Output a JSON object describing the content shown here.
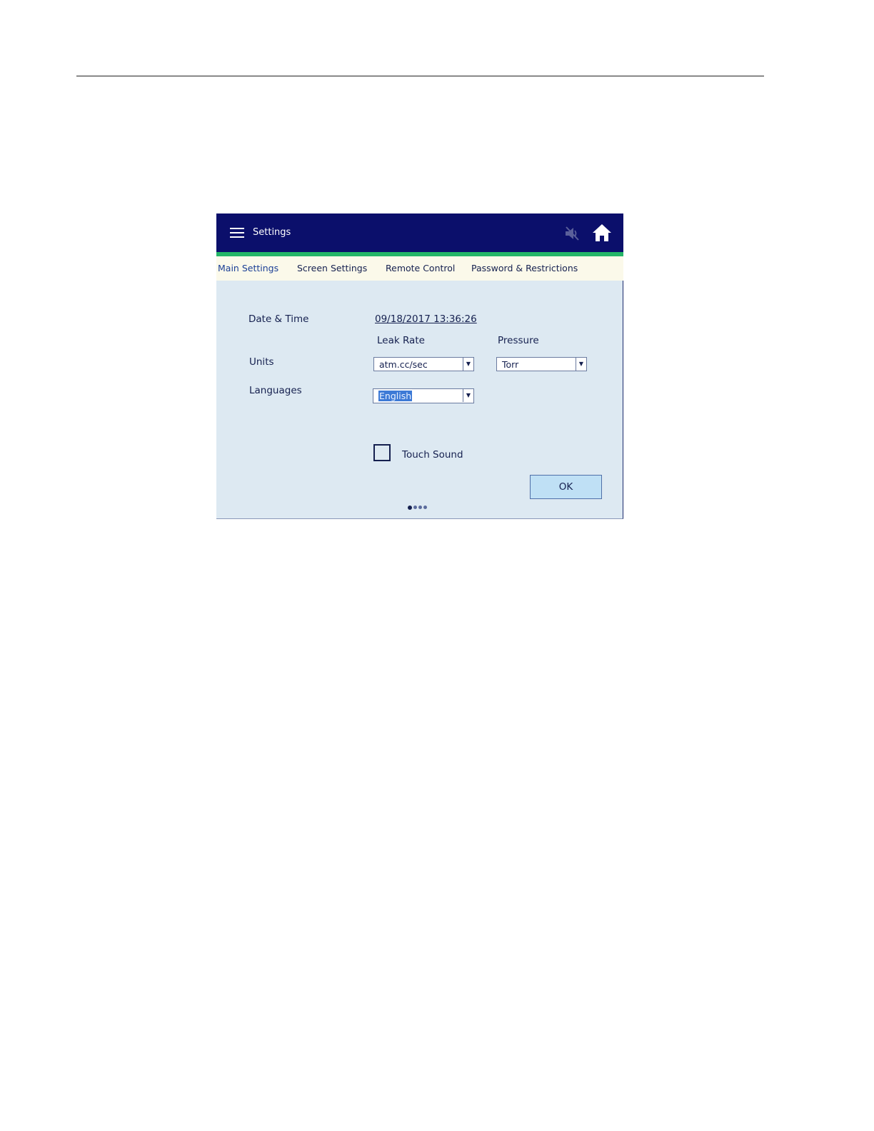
{
  "header": {
    "title": "Settings",
    "menu_icon": "hamburger-menu-icon",
    "mute_icon": "speaker-muted-icon",
    "home_icon": "home-icon"
  },
  "tabs": [
    {
      "label": "Main Settings",
      "active": true
    },
    {
      "label": "Screen Settings",
      "active": false
    },
    {
      "label": "Remote Control",
      "active": false
    },
    {
      "label": "Password & Restrictions",
      "active": false
    }
  ],
  "main": {
    "date_time_label": "Date & Time",
    "date_time_value": "09/18/2017 13:36:26",
    "units_label": "Units",
    "leak_rate_header": "Leak Rate",
    "pressure_header": "Pressure",
    "leak_rate_value": "atm.cc/sec",
    "pressure_value": "Torr",
    "languages_label": "Languages",
    "language_value": "English",
    "touch_sound_label": "Touch Sound",
    "touch_sound_checked": false,
    "ok_label": "OK"
  },
  "pager": {
    "pages": 4,
    "current": 1
  },
  "colors": {
    "titlebar": "#0b0f6b",
    "accent_bar": "#24b567",
    "panel_bg": "#dde9f2",
    "tabstrip_bg": "#fbf9ea",
    "ok_bg": "#bfe0f5",
    "selection": "#3d7ad6"
  }
}
